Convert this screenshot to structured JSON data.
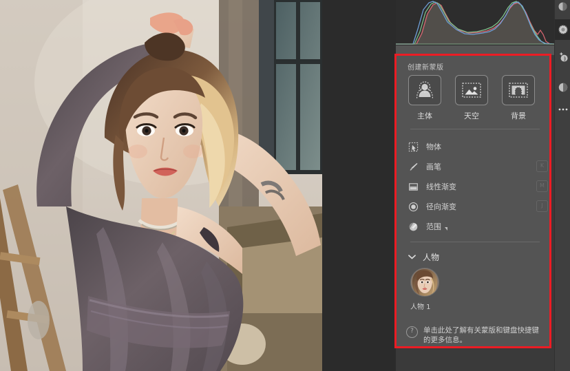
{
  "app": {
    "name": "photo-editor-mask-panel"
  },
  "canvas": {
    "photo_alt": "woman-portrait-arms-raised"
  },
  "histogram": {
    "name": "rgb-histogram",
    "channels": [
      "red",
      "green",
      "blue"
    ],
    "colors": {
      "red": "#d4646e",
      "green": "#7fc08a",
      "blue": "#6e9fd8",
      "luminance": "#b9b4ac"
    }
  },
  "tool_rail": {
    "items": [
      {
        "name": "crop-tool",
        "icon": "circle-half-icon"
      },
      {
        "name": "spot-removal-tool",
        "icon": "dotted-circle-icon",
        "selected": true
      },
      {
        "name": "red-eye-tool",
        "icon": "plus-circle-icon"
      },
      {
        "name": "masking-tool",
        "icon": "mask-circle-icon"
      },
      {
        "name": "more-tools",
        "icon": "ellipsis-icon"
      }
    ]
  },
  "mask_panel": {
    "title": "创建新蒙版",
    "accent_color": "#ec1c24",
    "background_color": "#545454",
    "create_buttons": [
      {
        "label": "主体",
        "icon": "subject-person-icon",
        "name": "create-mask-subject"
      },
      {
        "label": "天空",
        "icon": "sky-landscape-icon",
        "name": "create-mask-sky"
      },
      {
        "label": "背景",
        "icon": "background-arch-icon",
        "name": "create-mask-background"
      }
    ],
    "tools": [
      {
        "label": "物体",
        "icon": "object-select-icon",
        "shortcut": "",
        "name": "mask-tool-object"
      },
      {
        "label": "画笔",
        "icon": "brush-icon",
        "shortcut": "K",
        "name": "mask-tool-brush"
      },
      {
        "label": "线性渐变",
        "icon": "linear-gradient-icon",
        "shortcut": "M",
        "name": "mask-tool-linear-gradient"
      },
      {
        "label": "径向渐变",
        "icon": "radial-gradient-icon",
        "shortcut": "J",
        "name": "mask-tool-radial-gradient"
      },
      {
        "label": "范围",
        "icon": "range-icon",
        "shortcut": "",
        "has_caret": true,
        "name": "mask-tool-range"
      }
    ],
    "people": {
      "section_label": "人物",
      "expanded": true,
      "items": [
        {
          "label": "人物 1",
          "name": "person-1",
          "thumb": "face-thumbnail"
        }
      ]
    },
    "help": {
      "icon": "question-mark-icon",
      "text": "单击此处了解有关蒙版和键盘快捷键的更多信息。"
    }
  }
}
